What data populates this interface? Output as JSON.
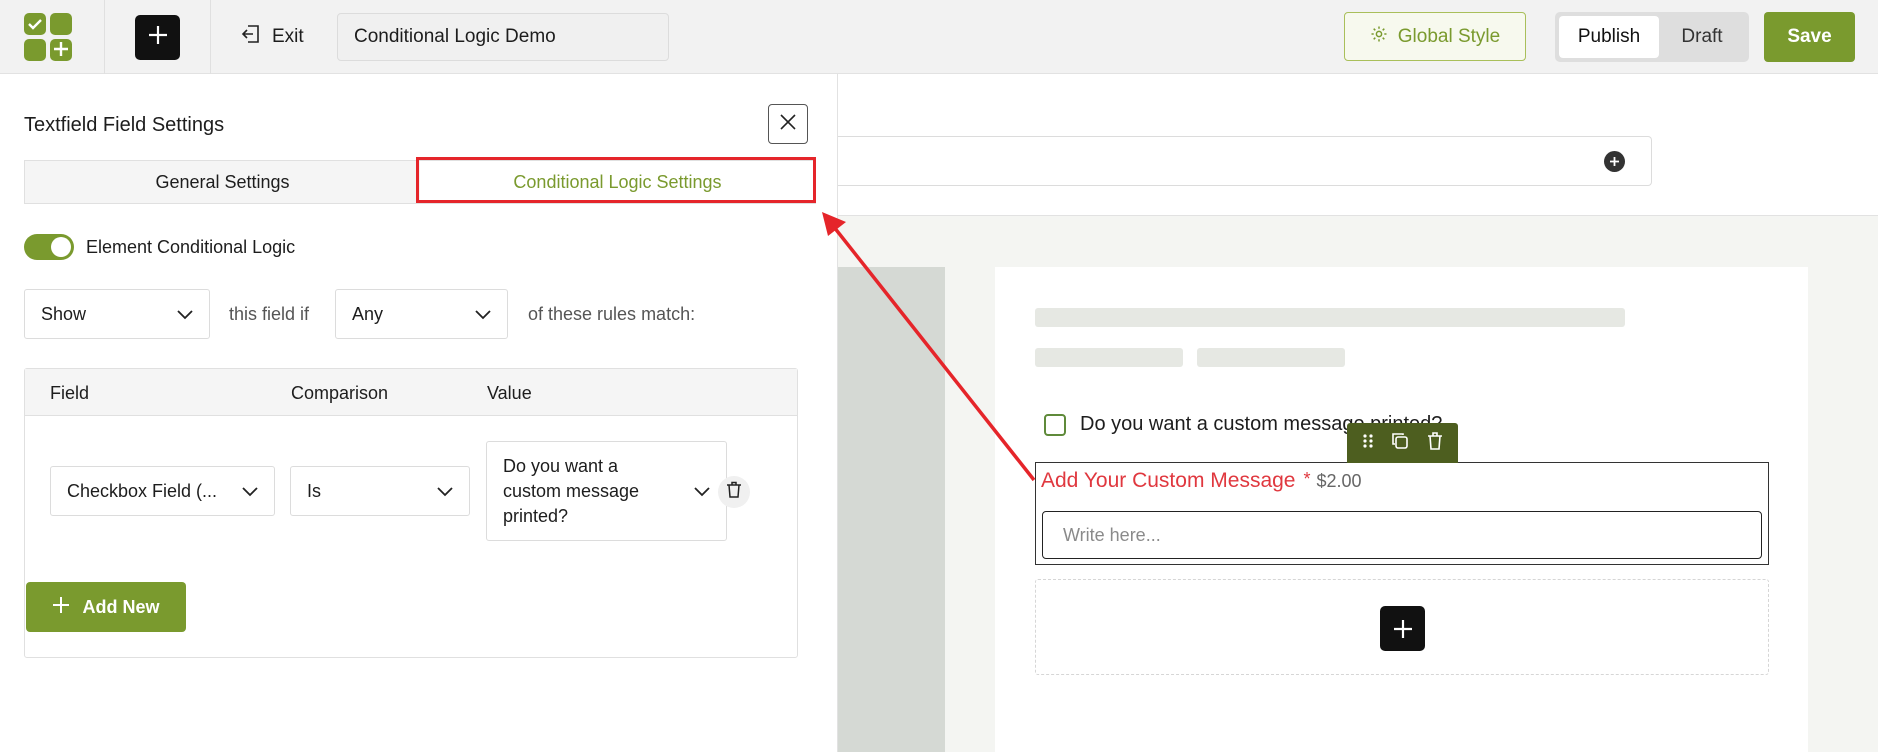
{
  "topbar": {
    "exit_label": "Exit",
    "form_title": "Conditional Logic Demo",
    "global_style_label": "Global Style",
    "publish_label": "Publish",
    "draft_label": "Draft",
    "save_label": "Save"
  },
  "panel": {
    "title": "Textfield Field Settings",
    "tabs": [
      {
        "label": "General Settings"
      },
      {
        "label": "Conditional Logic Settings"
      }
    ],
    "switch_label": "Element Conditional Logic",
    "action_value": "Show",
    "text_this_field_if": "this field if",
    "match_value": "Any",
    "text_rules_match": "of these rules match:",
    "table": {
      "headers": [
        "Field",
        "Comparison",
        "Value"
      ],
      "row": {
        "field": "Checkbox Field (...",
        "comparison": "Is",
        "value": "Do you want a\ncustom message\nprinted?"
      }
    },
    "add_new_label": "Add New"
  },
  "canvas": {
    "checkbox_label": "Do you want a custom message printed?",
    "field_label": "Add Your Custom Message",
    "required_mark": "*",
    "price": "$2.00",
    "input_placeholder": "Write here..."
  },
  "colors": {
    "accent": "#7a9a2e",
    "highlight": "#e5252a",
    "field_label": "#e0383f"
  }
}
